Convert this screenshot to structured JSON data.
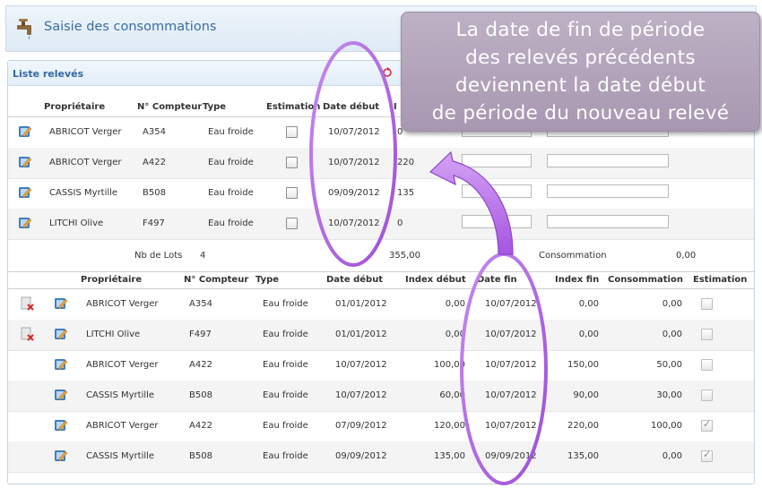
{
  "app": {
    "title": "Saisie des consommations"
  },
  "panel": {
    "title": "Liste relevés"
  },
  "top_table": {
    "headers": {
      "owner": "Propriétaire",
      "meter": "N° Compteur",
      "type": "Type",
      "estimation": "Estimation",
      "start_date": "Date début",
      "index_start": "I"
    },
    "rows": [
      {
        "owner": "ABRICOT Verger",
        "meter": "A354",
        "type": "Eau froide",
        "start_date": "10/07/2012",
        "index_start": "0",
        "estimation": false
      },
      {
        "owner": "ABRICOT Verger",
        "meter": "A422",
        "type": "Eau froide",
        "start_date": "10/07/2012",
        "index_start": "220",
        "estimation": false
      },
      {
        "owner": "CASSIS Myrtille",
        "meter": "B508",
        "type": "Eau froide",
        "start_date": "09/09/2012",
        "index_start": "135",
        "estimation": false
      },
      {
        "owner": "LITCHI Olive",
        "meter": "F497",
        "type": "Eau froide",
        "start_date": "10/07/2012",
        "index_start": "0",
        "estimation": false
      }
    ],
    "totals": {
      "lots_label": "Nb de Lots",
      "lots_value": "4",
      "index_total": "355,00",
      "consumption_label": "Consommation",
      "consumption_value": "0,00"
    }
  },
  "bottom_table": {
    "headers": {
      "owner": "Propriétaire",
      "meter": "N° Compteur",
      "type": "Type",
      "start_date": "Date début",
      "index_start": "Index début",
      "end_date": "Date fin",
      "index_end": "Index fin",
      "consumption": "Consommation",
      "estimation": "Estimation"
    },
    "rows": [
      {
        "owner": "ABRICOT Verger",
        "meter": "A354",
        "type": "Eau froide",
        "start_date": "01/01/2012",
        "index_start": "0,00",
        "end_date": "10/07/2012",
        "index_end": "0,00",
        "consumption": "0,00",
        "estimation": false,
        "deletable": true
      },
      {
        "owner": "LITCHI Olive",
        "meter": "F497",
        "type": "Eau froide",
        "start_date": "01/01/2012",
        "index_start": "0,00",
        "end_date": "10/07/2012",
        "index_end": "0,00",
        "consumption": "0,00",
        "estimation": false,
        "deletable": true
      },
      {
        "owner": "ABRICOT Verger",
        "meter": "A422",
        "type": "Eau froide",
        "start_date": "10/07/2012",
        "index_start": "100,00",
        "end_date": "10/07/2012",
        "index_end": "150,00",
        "consumption": "50,00",
        "estimation": false,
        "deletable": false
      },
      {
        "owner": "CASSIS Myrtille",
        "meter": "B508",
        "type": "Eau froide",
        "start_date": "10/07/2012",
        "index_start": "60,00",
        "end_date": "10/07/2012",
        "index_end": "90,00",
        "consumption": "30,00",
        "estimation": false,
        "deletable": false
      },
      {
        "owner": "ABRICOT Verger",
        "meter": "A422",
        "type": "Eau froide",
        "start_date": "07/09/2012",
        "index_start": "120,00",
        "end_date": "10/07/2012",
        "index_end": "220,00",
        "consumption": "100,00",
        "estimation": true,
        "deletable": false
      },
      {
        "owner": "CASSIS Myrtille",
        "meter": "B508",
        "type": "Eau froide",
        "start_date": "09/09/2012",
        "index_start": "135,00",
        "end_date": "09/09/2012",
        "index_end": "135,00",
        "consumption": "0,00",
        "estimation": true,
        "deletable": false
      }
    ]
  },
  "callout": {
    "lines": [
      "La date de fin de période",
      "des relevés précédents",
      "deviennent la date début",
      "de période du nouveau relevé"
    ]
  },
  "colors": {
    "accent": "#3a6ea5",
    "callout_bg": "#b3a3bc",
    "annotation": "#b36ee6"
  },
  "icons": [
    "tap-icon",
    "refresh-icon",
    "edit-icon",
    "delete-icon"
  ]
}
